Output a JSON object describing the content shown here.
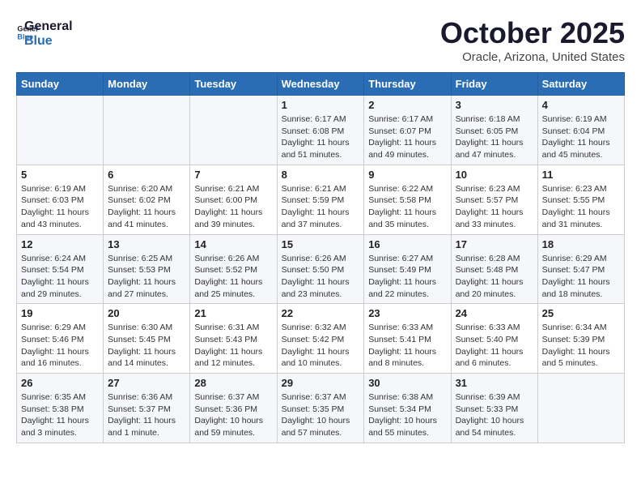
{
  "header": {
    "logo_line1": "General",
    "logo_line2": "Blue",
    "month": "October 2025",
    "location": "Oracle, Arizona, United States"
  },
  "weekdays": [
    "Sunday",
    "Monday",
    "Tuesday",
    "Wednesday",
    "Thursday",
    "Friday",
    "Saturday"
  ],
  "weeks": [
    [
      {
        "day": "",
        "content": ""
      },
      {
        "day": "",
        "content": ""
      },
      {
        "day": "",
        "content": ""
      },
      {
        "day": "1",
        "content": "Sunrise: 6:17 AM\nSunset: 6:08 PM\nDaylight: 11 hours\nand 51 minutes."
      },
      {
        "day": "2",
        "content": "Sunrise: 6:17 AM\nSunset: 6:07 PM\nDaylight: 11 hours\nand 49 minutes."
      },
      {
        "day": "3",
        "content": "Sunrise: 6:18 AM\nSunset: 6:05 PM\nDaylight: 11 hours\nand 47 minutes."
      },
      {
        "day": "4",
        "content": "Sunrise: 6:19 AM\nSunset: 6:04 PM\nDaylight: 11 hours\nand 45 minutes."
      }
    ],
    [
      {
        "day": "5",
        "content": "Sunrise: 6:19 AM\nSunset: 6:03 PM\nDaylight: 11 hours\nand 43 minutes."
      },
      {
        "day": "6",
        "content": "Sunrise: 6:20 AM\nSunset: 6:02 PM\nDaylight: 11 hours\nand 41 minutes."
      },
      {
        "day": "7",
        "content": "Sunrise: 6:21 AM\nSunset: 6:00 PM\nDaylight: 11 hours\nand 39 minutes."
      },
      {
        "day": "8",
        "content": "Sunrise: 6:21 AM\nSunset: 5:59 PM\nDaylight: 11 hours\nand 37 minutes."
      },
      {
        "day": "9",
        "content": "Sunrise: 6:22 AM\nSunset: 5:58 PM\nDaylight: 11 hours\nand 35 minutes."
      },
      {
        "day": "10",
        "content": "Sunrise: 6:23 AM\nSunset: 5:57 PM\nDaylight: 11 hours\nand 33 minutes."
      },
      {
        "day": "11",
        "content": "Sunrise: 6:23 AM\nSunset: 5:55 PM\nDaylight: 11 hours\nand 31 minutes."
      }
    ],
    [
      {
        "day": "12",
        "content": "Sunrise: 6:24 AM\nSunset: 5:54 PM\nDaylight: 11 hours\nand 29 minutes."
      },
      {
        "day": "13",
        "content": "Sunrise: 6:25 AM\nSunset: 5:53 PM\nDaylight: 11 hours\nand 27 minutes."
      },
      {
        "day": "14",
        "content": "Sunrise: 6:26 AM\nSunset: 5:52 PM\nDaylight: 11 hours\nand 25 minutes."
      },
      {
        "day": "15",
        "content": "Sunrise: 6:26 AM\nSunset: 5:50 PM\nDaylight: 11 hours\nand 23 minutes."
      },
      {
        "day": "16",
        "content": "Sunrise: 6:27 AM\nSunset: 5:49 PM\nDaylight: 11 hours\nand 22 minutes."
      },
      {
        "day": "17",
        "content": "Sunrise: 6:28 AM\nSunset: 5:48 PM\nDaylight: 11 hours\nand 20 minutes."
      },
      {
        "day": "18",
        "content": "Sunrise: 6:29 AM\nSunset: 5:47 PM\nDaylight: 11 hours\nand 18 minutes."
      }
    ],
    [
      {
        "day": "19",
        "content": "Sunrise: 6:29 AM\nSunset: 5:46 PM\nDaylight: 11 hours\nand 16 minutes."
      },
      {
        "day": "20",
        "content": "Sunrise: 6:30 AM\nSunset: 5:45 PM\nDaylight: 11 hours\nand 14 minutes."
      },
      {
        "day": "21",
        "content": "Sunrise: 6:31 AM\nSunset: 5:43 PM\nDaylight: 11 hours\nand 12 minutes."
      },
      {
        "day": "22",
        "content": "Sunrise: 6:32 AM\nSunset: 5:42 PM\nDaylight: 11 hours\nand 10 minutes."
      },
      {
        "day": "23",
        "content": "Sunrise: 6:33 AM\nSunset: 5:41 PM\nDaylight: 11 hours\nand 8 minutes."
      },
      {
        "day": "24",
        "content": "Sunrise: 6:33 AM\nSunset: 5:40 PM\nDaylight: 11 hours\nand 6 minutes."
      },
      {
        "day": "25",
        "content": "Sunrise: 6:34 AM\nSunset: 5:39 PM\nDaylight: 11 hours\nand 5 minutes."
      }
    ],
    [
      {
        "day": "26",
        "content": "Sunrise: 6:35 AM\nSunset: 5:38 PM\nDaylight: 11 hours\nand 3 minutes."
      },
      {
        "day": "27",
        "content": "Sunrise: 6:36 AM\nSunset: 5:37 PM\nDaylight: 11 hours\nand 1 minute."
      },
      {
        "day": "28",
        "content": "Sunrise: 6:37 AM\nSunset: 5:36 PM\nDaylight: 10 hours\nand 59 minutes."
      },
      {
        "day": "29",
        "content": "Sunrise: 6:37 AM\nSunset: 5:35 PM\nDaylight: 10 hours\nand 57 minutes."
      },
      {
        "day": "30",
        "content": "Sunrise: 6:38 AM\nSunset: 5:34 PM\nDaylight: 10 hours\nand 55 minutes."
      },
      {
        "day": "31",
        "content": "Sunrise: 6:39 AM\nSunset: 5:33 PM\nDaylight: 10 hours\nand 54 minutes."
      },
      {
        "day": "",
        "content": ""
      }
    ]
  ]
}
